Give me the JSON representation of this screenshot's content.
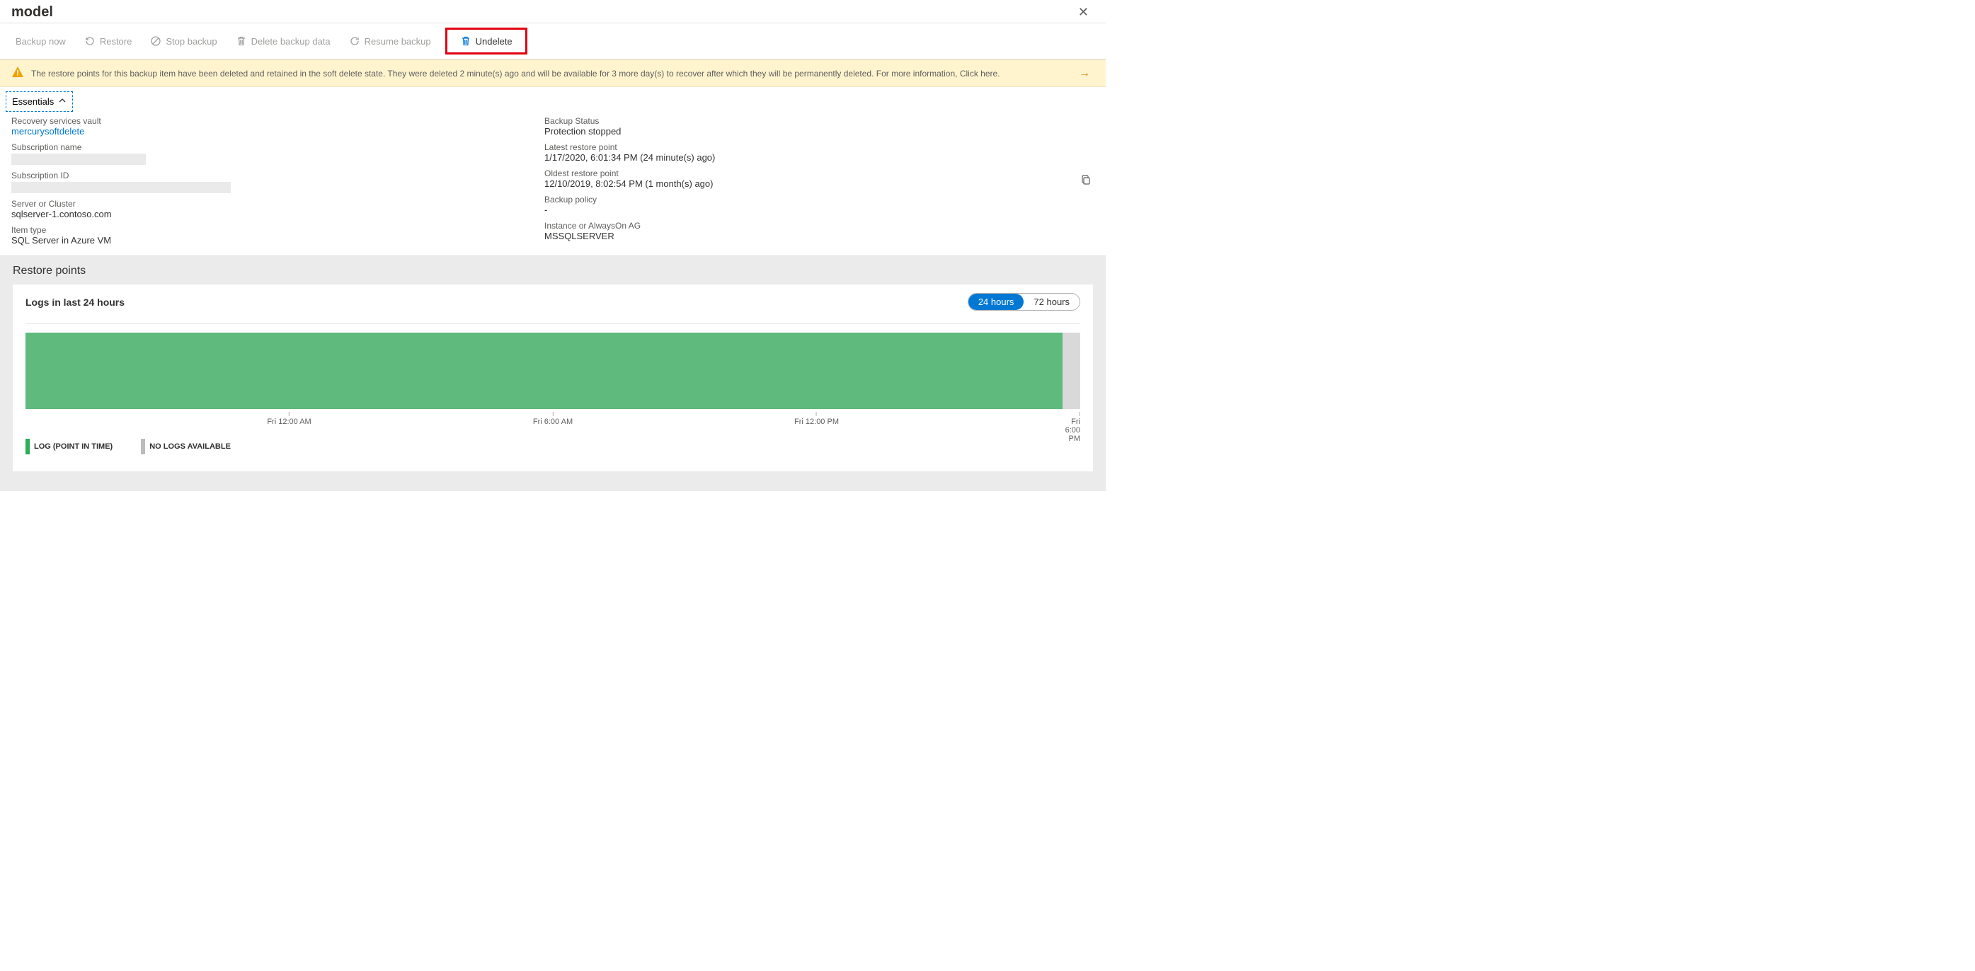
{
  "header": {
    "title": "model"
  },
  "toolbar": {
    "backup_now": "Backup now",
    "restore": "Restore",
    "stop_backup": "Stop backup",
    "delete_backup_data": "Delete backup data",
    "resume_backup": "Resume backup",
    "undelete": "Undelete"
  },
  "banner": {
    "text": "The restore points for this backup item have been deleted and retained in the soft delete state. They were deleted 2 minute(s) ago and will be available for 3 more day(s) to recover after which they will be permanently deleted. For more information, Click here."
  },
  "essentials": {
    "toggle_label": "Essentials",
    "left": {
      "recovery_vault_label": "Recovery services vault",
      "recovery_vault_value": "mercurysoftdelete",
      "subscription_name_label": "Subscription name",
      "subscription_id_label": "Subscription ID",
      "server_label": "Server or Cluster",
      "server_value": "sqlserver-1.contoso.com",
      "item_type_label": "Item type",
      "item_type_value": "SQL Server in Azure VM"
    },
    "right": {
      "backup_status_label": "Backup Status",
      "backup_status_value": "Protection stopped",
      "latest_restore_label": "Latest restore point",
      "latest_restore_value": "1/17/2020, 6:01:34 PM (24 minute(s) ago)",
      "oldest_restore_label": "Oldest restore point",
      "oldest_restore_value": "12/10/2019, 8:02:54 PM (1 month(s) ago)",
      "backup_policy_label": "Backup policy",
      "backup_policy_value": "-",
      "instance_label": "Instance or AlwaysOn AG",
      "instance_value": "MSSQLSERVER"
    }
  },
  "restore": {
    "heading": "Restore points",
    "panel_title": "Logs in last 24 hours",
    "pill_24": "24 hours",
    "pill_72": "72 hours",
    "legend_log": "LOG (POINT IN TIME)",
    "legend_nolog": "NO LOGS AVAILABLE",
    "ticks": [
      "Fri 12:00 AM",
      "Fri 6:00 AM",
      "Fri 12:00 PM",
      "Fri 6:00 PM"
    ]
  },
  "chart_data": {
    "type": "bar",
    "title": "Logs in last 24 hours",
    "xlabel": "",
    "ylabel": "",
    "x_ticks": [
      "Fri 12:00 AM",
      "Fri 6:00 AM",
      "Fri 12:00 PM",
      "Fri 6:00 PM"
    ],
    "series": [
      {
        "name": "LOG (POINT IN TIME)",
        "color": "#5fba7d",
        "coverage_fraction": 0.983
      },
      {
        "name": "NO LOGS AVAILABLE",
        "color": "#d9d9d9",
        "coverage_fraction": 0.017
      }
    ]
  }
}
